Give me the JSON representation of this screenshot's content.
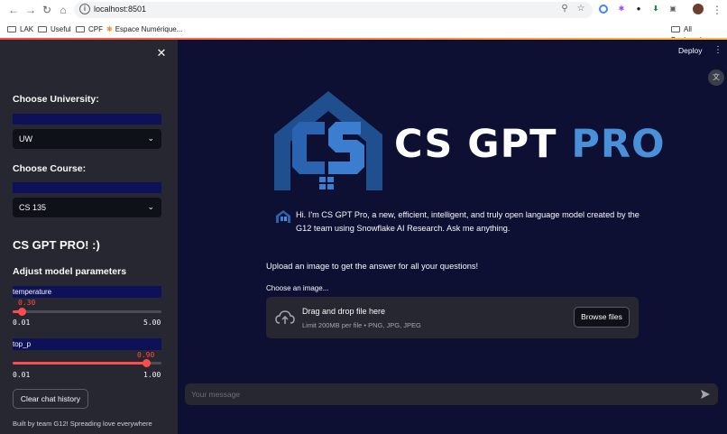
{
  "browser": {
    "url": "localhost:8501",
    "bookmarks": [
      "LAK",
      "Useful",
      "CPF",
      "Espace Numérique..."
    ],
    "all_bookmarks": "All Bookmarks"
  },
  "sidebar": {
    "university_label": "Choose University:",
    "university_value": "UW",
    "course_label": "Choose Course:",
    "course_value": "CS 135",
    "heading": "CS GPT PRO! :)",
    "params_heading": "Adjust model parameters",
    "temperature": {
      "label": "temperature",
      "value": "0.30",
      "min": "0.01",
      "max": "5.00",
      "fraction": 0.058
    },
    "top_p": {
      "label": "top_p",
      "value": "0.90",
      "min": "0.01",
      "max": "1.00",
      "fraction": 0.899
    },
    "clear_button": "Clear chat history",
    "footer": "Built by team G12! Spreading love everywhere"
  },
  "main": {
    "deploy": "Deploy",
    "brand_white": "CS GPT ",
    "brand_blue": "PRO",
    "intro": "Hi. I'm CS GPT Pro, a new, efficient, intelligent, and truly open language model created by the G12 team using Snowflake AI Research. Ask me anything.",
    "upload_heading": "Upload an image to get the answer for all your questions!",
    "choose_image": "Choose an image...",
    "dropzone_title": "Drag and drop file here",
    "dropzone_sub": "Limit 200MB per file • PNG, JPG, JPEG",
    "browse_button": "Browse files",
    "chat_placeholder": "Your message"
  },
  "colors": {
    "accent": "#ff4b4b",
    "brand_blue": "#4a90d9",
    "main_bg": "#0d1033",
    "sidebar_bg": "#262730"
  }
}
